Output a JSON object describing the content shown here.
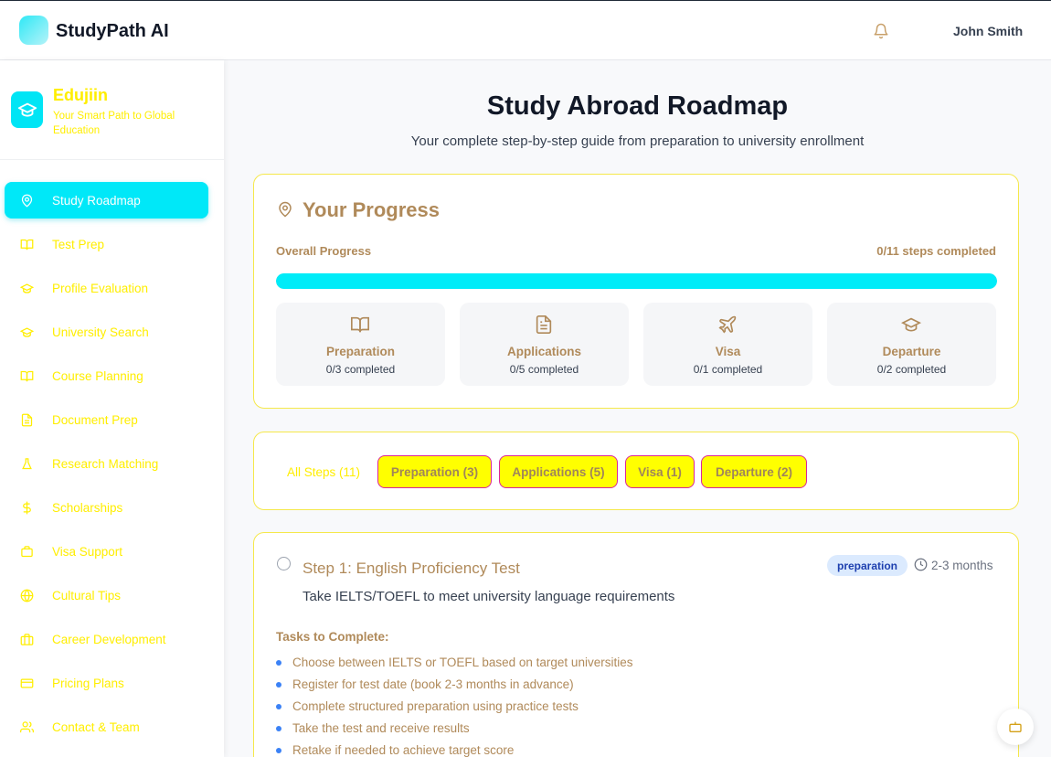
{
  "app": {
    "title": "StudyPath AI",
    "user_name": "John Smith"
  },
  "sidebar": {
    "brand_name": "Edujiin",
    "brand_tagline": "Your Smart Path to Global Education",
    "items": [
      {
        "label": "Study Roadmap",
        "icon": "map-pin-icon",
        "active": true
      },
      {
        "label": "Test Prep",
        "icon": "book-open-icon"
      },
      {
        "label": "Profile Evaluation",
        "icon": "graduation-cap-icon"
      },
      {
        "label": "University Search",
        "icon": "graduation-cap-icon"
      },
      {
        "label": "Course Planning",
        "icon": "book-open-icon"
      },
      {
        "label": "Document Prep",
        "icon": "file-text-icon"
      },
      {
        "label": "Research Matching",
        "icon": "flask-icon"
      },
      {
        "label": "Scholarships",
        "icon": "dollar-icon"
      },
      {
        "label": "Visa Support",
        "icon": "passport-icon"
      },
      {
        "label": "Cultural Tips",
        "icon": "globe-icon"
      },
      {
        "label": "Career Development",
        "icon": "briefcase-icon"
      },
      {
        "label": "Pricing Plans",
        "icon": "credit-card-icon"
      },
      {
        "label": "Contact & Team",
        "icon": "users-icon"
      }
    ]
  },
  "main": {
    "title": "Study Abroad Roadmap",
    "subtitle": "Your complete step-by-step guide from preparation to university enrollment"
  },
  "progress": {
    "title": "Your Progress",
    "overall_label": "Overall Progress",
    "steps_completed": "0/11 steps completed",
    "bar_fraction": 1.0,
    "categories": [
      {
        "name": "Preparation",
        "count": "0/3 completed",
        "icon": "book-open-icon"
      },
      {
        "name": "Applications",
        "count": "0/5 completed",
        "icon": "file-text-icon"
      },
      {
        "name": "Visa",
        "count": "0/1 completed",
        "icon": "plane-icon"
      },
      {
        "name": "Departure",
        "count": "0/2 completed",
        "icon": "graduation-cap-icon"
      }
    ]
  },
  "filters": {
    "all": "All Steps (11)",
    "chips": [
      "Preparation  (3)",
      "Applications  (5)",
      "Visa  (1)",
      "Departure  (2)"
    ]
  },
  "step": {
    "title": "Step 1: English Proficiency Test",
    "badge": "preparation",
    "duration": "2-3 months",
    "description": "Take IELTS/TOEFL to meet university language requirements",
    "tasks_heading": "Tasks to Complete:",
    "tasks": [
      "Choose between IELTS or TOEFL based on target universities",
      "Register for test date (book 2-3 months in advance)",
      "Complete structured preparation using practice tests",
      "Take the test and receive results",
      "Retake if needed to achieve target score"
    ]
  },
  "colors": {
    "accent": "#00e8f8",
    "sidebar_text": "#ffee00",
    "heading_brown": "#b08a5a",
    "chip_fill": "#ffff00",
    "chip_border": "#d9269b"
  }
}
